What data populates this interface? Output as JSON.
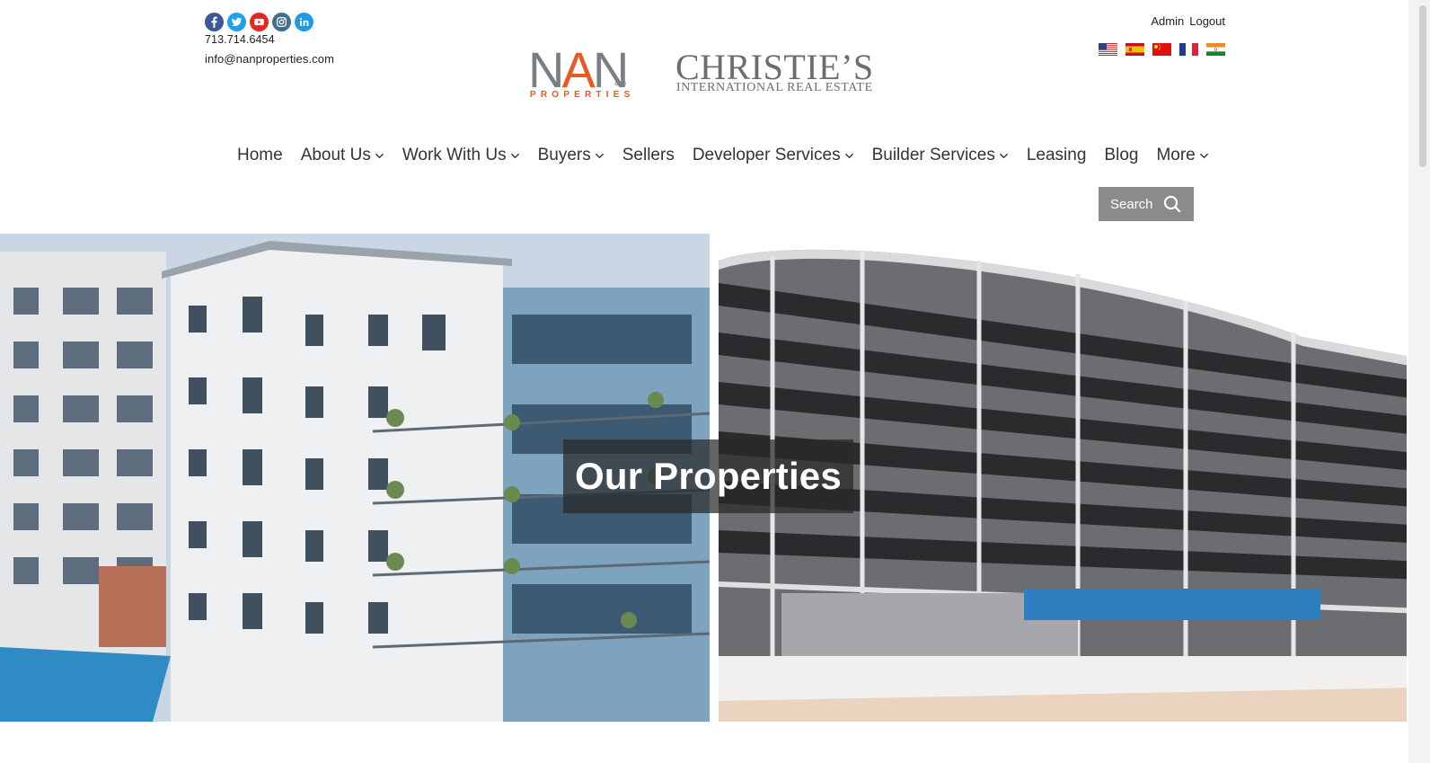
{
  "contact": {
    "phone": "713.714.6454",
    "email": "info@nanproperties.com"
  },
  "social": [
    "facebook-icon",
    "twitter-icon",
    "youtube-icon",
    "instagram-icon",
    "linkedin-icon"
  ],
  "account": {
    "admin_label": "Admin",
    "logout_label": "Logout"
  },
  "languages": [
    "us-flag",
    "spain-flag",
    "china-flag",
    "france-flag",
    "india-flag"
  ],
  "logos": {
    "nan_word_1": "N",
    "nan_word_2": "A",
    "nan_word_3": "N",
    "nan_sub": "PROPERTIES",
    "nan_co": "&CO",
    "christies_main": "CHRISTIE’S",
    "christies_sub": "INTERNATIONAL REAL ESTATE"
  },
  "nav": {
    "items": [
      {
        "label": "Home",
        "dropdown": false
      },
      {
        "label": "About Us",
        "dropdown": true
      },
      {
        "label": "Work With Us",
        "dropdown": true
      },
      {
        "label": "Buyers",
        "dropdown": true
      },
      {
        "label": "Sellers",
        "dropdown": false
      },
      {
        "label": "Developer Services",
        "dropdown": true
      },
      {
        "label": "Builder Services",
        "dropdown": true
      },
      {
        "label": "Leasing",
        "dropdown": false
      },
      {
        "label": "Blog",
        "dropdown": false
      },
      {
        "label": "More",
        "dropdown": true
      }
    ],
    "search_label": "Search"
  },
  "hero": {
    "title": "Our Properties"
  },
  "colors": {
    "accent_orange": "#e45a22",
    "logo_gray": "#6a6e73",
    "search_button": "#8b8b8b"
  }
}
